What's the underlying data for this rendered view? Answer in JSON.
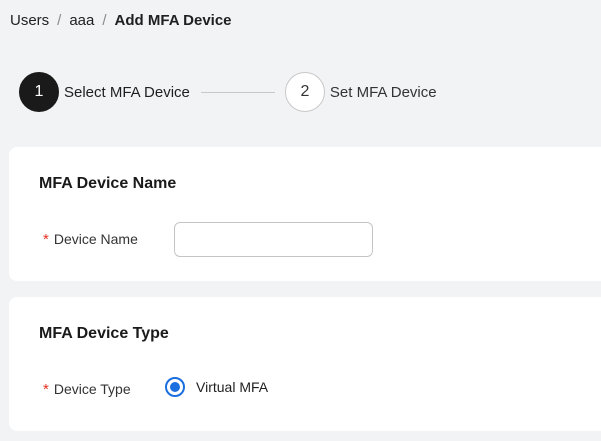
{
  "breadcrumb": {
    "items": [
      "Users",
      "aaa"
    ],
    "current": "Add MFA Device",
    "separator": "/"
  },
  "steps": [
    {
      "number": "1",
      "label": "Select MFA Device",
      "state": "active"
    },
    {
      "number": "2",
      "label": "Set MFA Device",
      "state": "inactive"
    }
  ],
  "name_section": {
    "title": "MFA Device Name",
    "required_mark": "*",
    "field_label": "Device Name",
    "value": "",
    "placeholder": ""
  },
  "type_section": {
    "title": "MFA Device Type",
    "required_mark": "*",
    "field_label": "Device Type",
    "options": [
      {
        "label": "Virtual MFA",
        "selected": true
      }
    ]
  },
  "colors": {
    "accent": "#1a6fe0",
    "required": "#e0301e",
    "active_step": "#1a1a1a",
    "background": "#f1f3f5"
  }
}
